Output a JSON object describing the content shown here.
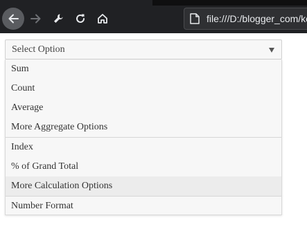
{
  "browser": {
    "address": "file:///D:/blogger_com/ko",
    "icons": [
      "back-arrow-icon",
      "forward-arrow-icon",
      "wrench-icon",
      "reload-icon",
      "home-icon",
      "page-icon"
    ]
  },
  "select": {
    "selected": "Select Option",
    "groups": [
      {
        "options": [
          "Sum",
          "Count",
          "Average",
          "More Aggregate Options"
        ]
      },
      {
        "options": [
          "Index",
          "% of Grand Total",
          "More Calculation Options"
        ]
      },
      {
        "options": [
          "Number Format"
        ]
      }
    ],
    "highlighted": "More Calculation Options"
  },
  "colors": {
    "toolbar": "#202124",
    "panel": "#f7f7f7",
    "highlight": "#ececec"
  }
}
